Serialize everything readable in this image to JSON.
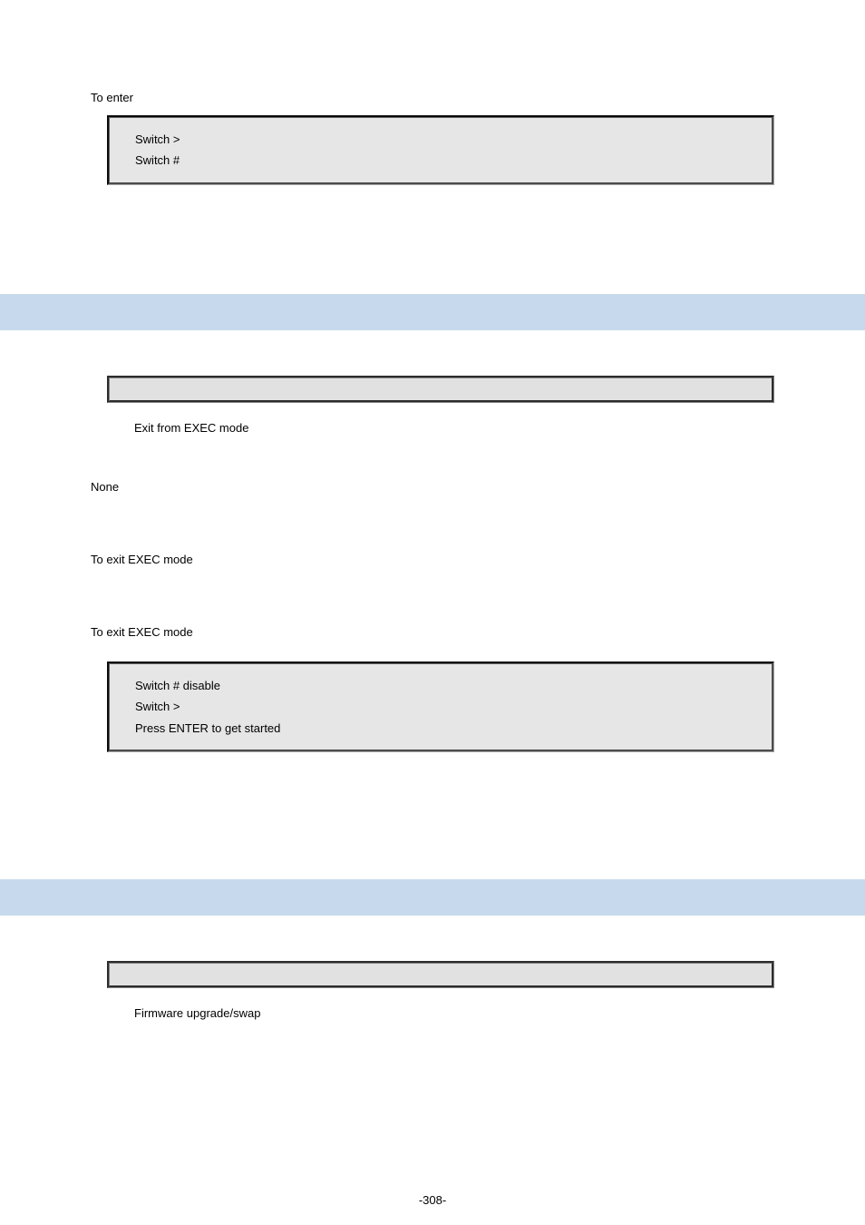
{
  "section1": {
    "intro": "To enter",
    "code_lines": [
      "Switch >",
      "Switch #"
    ]
  },
  "section2": {
    "desc": "Exit from EXEC mode",
    "default_label": "None",
    "usage_label": "To exit EXEC mode",
    "example_label": "To exit EXEC mode",
    "code_lines": [
      "Switch # disable",
      "Switch >",
      "",
      "Press ENTER to get started"
    ]
  },
  "section3": {
    "desc": "Firmware upgrade/swap"
  },
  "page_number": "-308-"
}
